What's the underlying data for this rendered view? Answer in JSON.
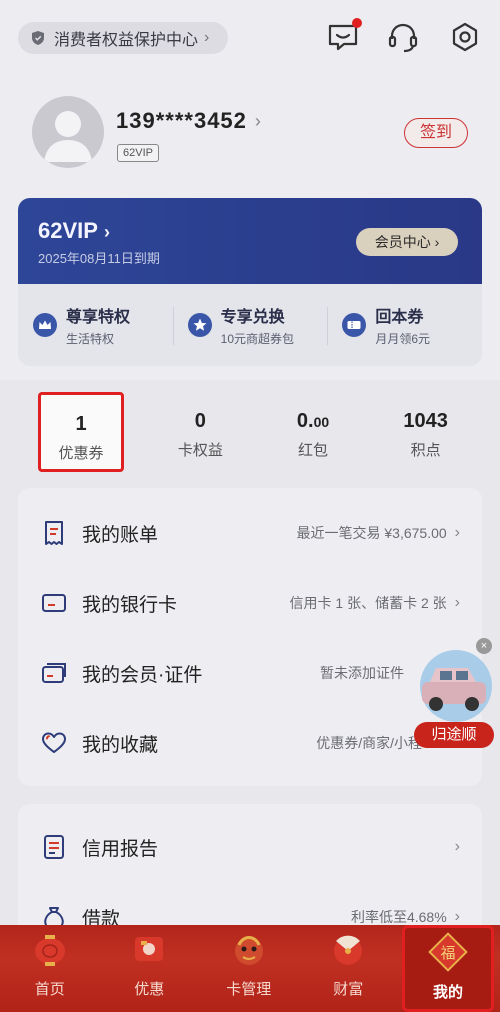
{
  "header": {
    "protection_label": "消费者权益保护中心",
    "icons": [
      "message-icon",
      "customer-service-icon",
      "settings-icon"
    ]
  },
  "profile": {
    "phone": "139****3452",
    "vip_tag": "62VIP",
    "signin_label": "签到"
  },
  "vip_card": {
    "title": "62VIP",
    "expire": "2025年08月11日到期",
    "member_center": "会员中心",
    "benefits": [
      {
        "title": "尊享特权",
        "sub": "生活特权",
        "icon": "crown-icon"
      },
      {
        "title": "专享兑换",
        "sub": "10元商超券包",
        "icon": "star-icon"
      },
      {
        "title": "回本券",
        "sub": "月月领6元",
        "icon": "ticket-icon"
      }
    ]
  },
  "stats": [
    {
      "value": "1",
      "label": "优惠券"
    },
    {
      "value": "0",
      "label": "卡权益"
    },
    {
      "value_main": "0.",
      "value_small": "00",
      "label": "红包"
    },
    {
      "value": "1043",
      "label": "积点"
    }
  ],
  "menu": [
    {
      "label": "我的账单",
      "desc": "最近一笔交易 ¥3,675.00",
      "icon": "bill-icon"
    },
    {
      "label": "我的银行卡",
      "desc": "信用卡 1 张、储蓄卡 2 张",
      "icon": "bank-card-icon"
    },
    {
      "label": "我的会员·证件",
      "desc": "暂未添加证件",
      "icon": "member-card-icon"
    },
    {
      "label": "我的收藏",
      "desc": "优惠券/商家/小程",
      "icon": "heart-icon"
    }
  ],
  "menu2": [
    {
      "label": "信用报告",
      "desc": "",
      "icon": "report-icon"
    },
    {
      "label": "借款",
      "desc": "利率低至4.68%",
      "icon": "loan-icon"
    }
  ],
  "float_ad": {
    "label": "归途顺"
  },
  "bottom_nav": [
    {
      "label": "首页",
      "icon": "lantern-icon"
    },
    {
      "label": "优惠",
      "icon": "gift-icon"
    },
    {
      "label": "卡管理",
      "icon": "dragon-icon"
    },
    {
      "label": "财富",
      "icon": "fan-icon"
    },
    {
      "label": "我的",
      "icon": "fu-icon"
    }
  ],
  "colors": {
    "brand_red": "#c8241c",
    "vip_blue": "#2b3e8e",
    "highlight_red": "#e02020"
  }
}
